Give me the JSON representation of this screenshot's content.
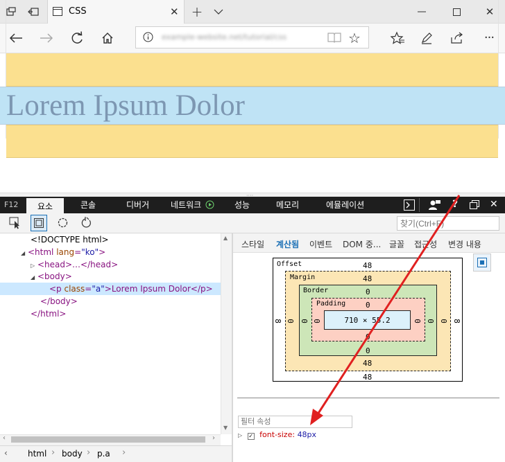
{
  "browser": {
    "tab_title": "CSS",
    "address_url": "example-website.net/tutorial/css"
  },
  "page": {
    "heading_text": "Lorem Ipsum Dolor"
  },
  "devtools": {
    "f12_label": "F12",
    "tabs": [
      "요소",
      "콘솔",
      "디버거",
      "네트워크",
      "성능",
      "메모리",
      "에뮬레이션"
    ],
    "find_placeholder": "찾기(Ctrl+F)",
    "dom_tree": {
      "doctype": "<!DOCTYPE html>",
      "html_open_tag": "<html",
      "html_lang_attr": "lang",
      "html_lang_value": "\"ko\"",
      "html_close_bracket": ">",
      "head": "<head>…</head>",
      "body_open": "<body>",
      "p_open": "<p",
      "p_class_attr": "class",
      "p_class_value": "\"a\"",
      "p_text": ">Lorem Ipsum Dolor</p>",
      "body_close": "</body>",
      "html_close": "</html>"
    },
    "breadcrumbs": [
      "html",
      "body",
      "p.a"
    ],
    "right_tabs": [
      "스타일",
      "계산됨",
      "이벤트",
      "DOM 중...",
      "글꼴",
      "접근성",
      "변경 내용"
    ],
    "box_model": {
      "offset_label": "Offset",
      "margin_label": "Margin",
      "border_label": "Border",
      "padding_label": "Padding",
      "offset_top": "48",
      "offset_bottom": "48",
      "margin_top": "48",
      "margin_bottom": "48",
      "margin_left": "0",
      "margin_right": "0",
      "border_top": "0",
      "border_bottom": "0",
      "border_left": "0",
      "border_right": "0",
      "padding_top": "0",
      "padding_bottom": "0",
      "padding_left": "0",
      "padding_right": "0",
      "offset_left": "8",
      "offset_right": "8",
      "content_size": "710 × 55.2"
    },
    "filter_placeholder": "필터 속성",
    "computed_property": {
      "name": "font-size:",
      "value": "48px"
    }
  },
  "colors": {
    "margin_highlight": "#fbe08f",
    "content_highlight": "#bfe3f5",
    "arrow": "#e02020",
    "selected_row": "#cce8ff"
  }
}
